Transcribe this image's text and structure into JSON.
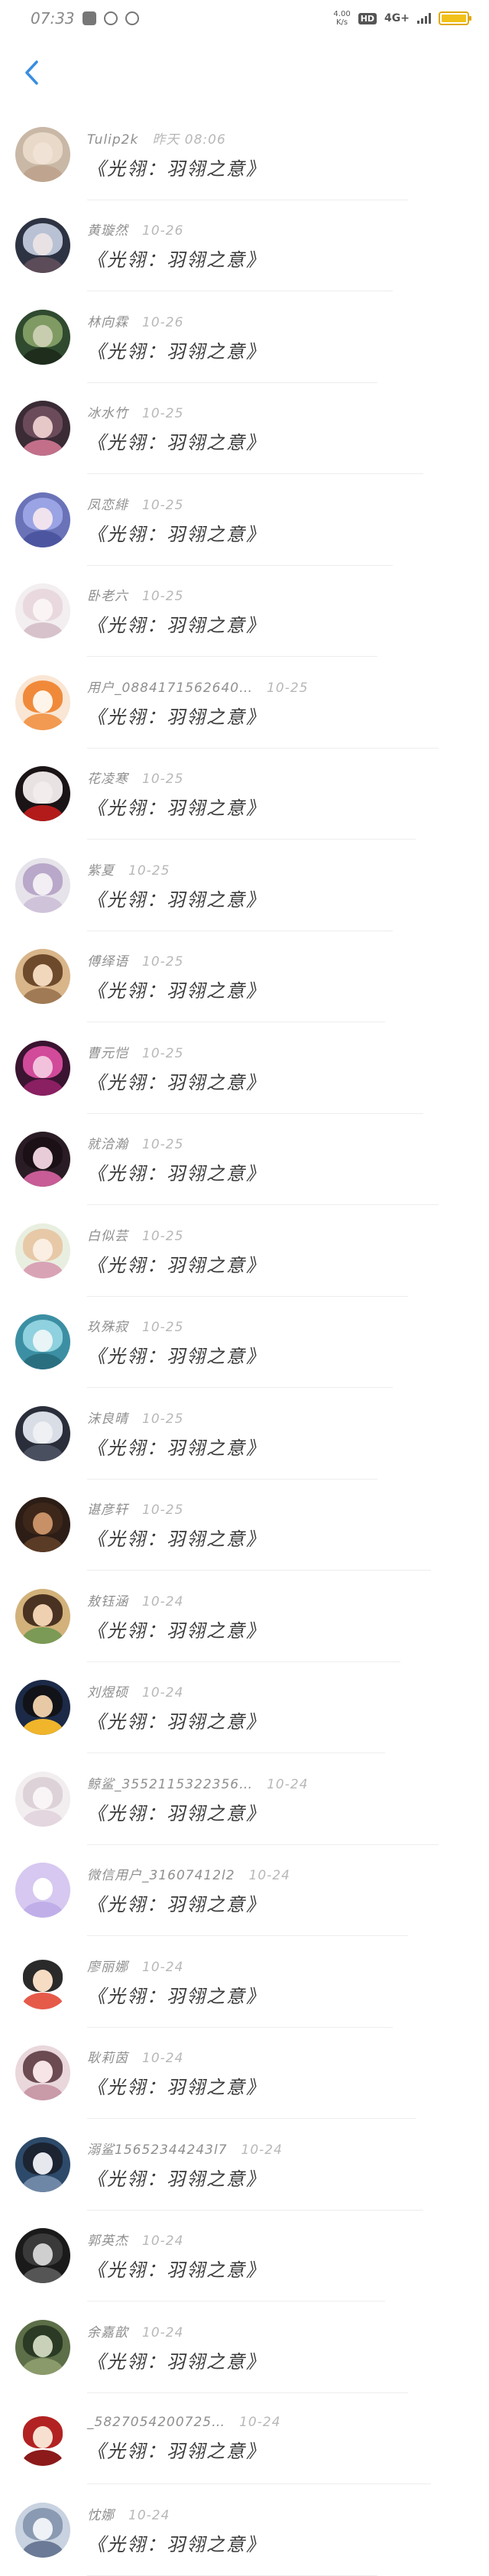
{
  "status_bar": {
    "time": "07:33",
    "net_speed_value": "4.00",
    "net_speed_unit": "K/s",
    "hd_label": "HD",
    "signal_label": "4G+",
    "battery_level": 1.0,
    "battery_color": "#f2c21b"
  },
  "nav": {
    "back_icon": "chevron-left-icon",
    "accent": "#3a8de0"
  },
  "rows": [
    {
      "name": "Tulip2k",
      "time": "昨天 08:06",
      "message": "《光翎：羽翎之意》",
      "avatar": {
        "bg": "#c9b8a6",
        "hair": "#e8d9c8",
        "face": "#f1e2d6",
        "body": "#bfa58f"
      }
    },
    {
      "name": "黄璇然",
      "time": "10-26",
      "message": "《光翎：羽翎之意》",
      "avatar": {
        "bg": "#2d3342",
        "hair": "#b9c2d4",
        "face": "#e9e2e4",
        "body": "#5c4b58"
      }
    },
    {
      "name": "林向霖",
      "time": "10-26",
      "message": "《光翎：羽翎之意》",
      "avatar": {
        "bg": "#2f4a2f",
        "hair": "#7f9b63",
        "face": "#c9cdb0",
        "body": "#1e2d1c"
      }
    },
    {
      "name": "冰水竹",
      "time": "10-25",
      "message": "《光翎：羽翎之意》",
      "avatar": {
        "bg": "#3a2b35",
        "hair": "#6b4b5a",
        "face": "#e6c8c8",
        "body": "#c36f8a"
      }
    },
    {
      "name": "凤恋緋",
      "time": "10-25",
      "message": "《光翎：羽翎之意》",
      "avatar": {
        "bg": "#6a73b8",
        "hair": "#9aa3e4",
        "face": "#f0e3ee",
        "body": "#4c56a0"
      }
    },
    {
      "name": "卧老六",
      "time": "10-25",
      "message": "《光翎：羽翎之意》",
      "avatar": {
        "bg": "#f3eef0",
        "hair": "#e9d9df",
        "face": "#fbf4f5",
        "body": "#d7c2cb"
      }
    },
    {
      "name": "用户_0884171562640…",
      "time": "10-25",
      "message": "《光翎：羽翎之意》",
      "avatar": {
        "bg": "#f9e6d4",
        "hair": "#f08a3a",
        "face": "#fff4ea",
        "body": "#f29a52"
      }
    },
    {
      "name": "花凌寒",
      "time": "10-25",
      "message": "《光翎：羽翎之意》",
      "avatar": {
        "bg": "#1a1416",
        "hair": "#e8e2e2",
        "face": "#f2ecec",
        "body": "#b31b1b"
      }
    },
    {
      "name": "紫夏",
      "time": "10-25",
      "message": "《光翎：羽翎之意》",
      "avatar": {
        "bg": "#e6e3ea",
        "hair": "#b9a8c9",
        "face": "#f2eef3",
        "body": "#cfc3da"
      }
    },
    {
      "name": "傅绎语",
      "time": "10-25",
      "message": "《光翎：羽翎之意》",
      "avatar": {
        "bg": "#d9b58a",
        "hair": "#6e4a2c",
        "face": "#f1d8bd",
        "body": "#a07a55"
      }
    },
    {
      "name": "曹元恺",
      "time": "10-25",
      "message": "《光翎：羽翎之意》",
      "avatar": {
        "bg": "#3a1430",
        "hair": "#d24a9a",
        "face": "#f2c2dc",
        "body": "#8a1f62"
      }
    },
    {
      "name": "就洽瀚",
      "time": "10-25",
      "message": "《光翎：羽翎之意》",
      "avatar": {
        "bg": "#2a1c24",
        "hair": "#1a1015",
        "face": "#e8cdd8",
        "body": "#c75c96"
      }
    },
    {
      "name": "白似芸",
      "time": "10-25",
      "message": "《光翎：羽翎之意》",
      "avatar": {
        "bg": "#e9efe0",
        "hair": "#e7c9a8",
        "face": "#fbeee2",
        "body": "#d9a3b6"
      }
    },
    {
      "name": "玖殊寂",
      "time": "10-25",
      "message": "《光翎：羽翎之意》",
      "avatar": {
        "bg": "#3c8fa3",
        "hair": "#8fd1de",
        "face": "#e8f4f6",
        "body": "#2a6f80"
      }
    },
    {
      "name": "沫良晴",
      "time": "10-25",
      "message": "《光翎：羽翎之意》",
      "avatar": {
        "bg": "#2a2e3a",
        "hair": "#d9dde6",
        "face": "#eef0f4",
        "body": "#4a4f60"
      }
    },
    {
      "name": "谌彦轩",
      "time": "10-25",
      "message": "《光翎：羽翎之意》",
      "avatar": {
        "bg": "#2c1d16",
        "hair": "#3d271a",
        "face": "#c79066",
        "body": "#5a3b26"
      }
    },
    {
      "name": "敖钰涵",
      "time": "10-24",
      "message": "《光翎：羽翎之意》",
      "avatar": {
        "bg": "#d2b27a",
        "hair": "#4a3222",
        "face": "#efd0b0",
        "body": "#7a9a55"
      }
    },
    {
      "name": "刘煜硕",
      "time": "10-24",
      "message": "《光翎：羽翎之意》",
      "avatar": {
        "bg": "#1c2a48",
        "hair": "#111318",
        "face": "#e7c9a6",
        "body": "#f0b52a"
      }
    },
    {
      "name": "鲸鲨_3552115322356…",
      "time": "10-24",
      "message": "《光翎：羽翎之意》",
      "avatar": {
        "bg": "#f2eef0",
        "hair": "#ddd2d8",
        "face": "#f9f5f7",
        "body": "#e3d6de"
      }
    },
    {
      "name": "微信用户_31607412l2",
      "time": "10-24",
      "message": "《光翎：羽翎之意》",
      "avatar": {
        "bg": "#d6c8f0",
        "hair": "#d6c8f0",
        "face": "#ffffff",
        "body": "#c0aee8"
      }
    },
    {
      "name": "廖丽娜",
      "time": "10-24",
      "message": "《光翎：羽翎之意》",
      "avatar": {
        "bg": "#ffffff",
        "hair": "#2a2a2a",
        "face": "#f7dcc4",
        "body": "#e65a4a"
      }
    },
    {
      "name": "耿莉茵",
      "time": "10-24",
      "message": "《光翎：羽翎之意》",
      "avatar": {
        "bg": "#e9d7dc",
        "hair": "#6b4a52",
        "face": "#f6e4e6",
        "body": "#c99aa8"
      }
    },
    {
      "name": "溺鲨15652344243l7",
      "time": "10-24",
      "message": "《光翎：羽翎之意》",
      "avatar": {
        "bg": "#2d4a6a",
        "hair": "#1c2432",
        "face": "#e6e8ee",
        "body": "#6f87a6"
      }
    },
    {
      "name": "郭英杰",
      "time": "10-24",
      "message": "《光翎：羽翎之意》",
      "avatar": {
        "bg": "#1a1a1a",
        "hair": "#3a3a3a",
        "face": "#cfcfcf",
        "body": "#555555"
      }
    },
    {
      "name": "余嘉歆",
      "time": "10-24",
      "message": "《光翎：羽翎之意》",
      "avatar": {
        "bg": "#5c6f48",
        "hair": "#2a3a24",
        "face": "#c9d2b8",
        "body": "#8a9a6a"
      }
    },
    {
      "name": "_5827054200725…",
      "time": "10-24",
      "message": "《光翎：羽翎之意》",
      "avatar": {
        "bg": "#ffffff",
        "hair": "#b22222",
        "face": "#f7e0d0",
        "body": "#8c1a1a"
      }
    },
    {
      "name": "忱娜",
      "time": "10-24",
      "message": "《光翎：羽翎之意》",
      "avatar": {
        "bg": "#c8d2e0",
        "hair": "#8a9ab2",
        "face": "#eef1f6",
        "body": "#6b7a96"
      }
    }
  ]
}
